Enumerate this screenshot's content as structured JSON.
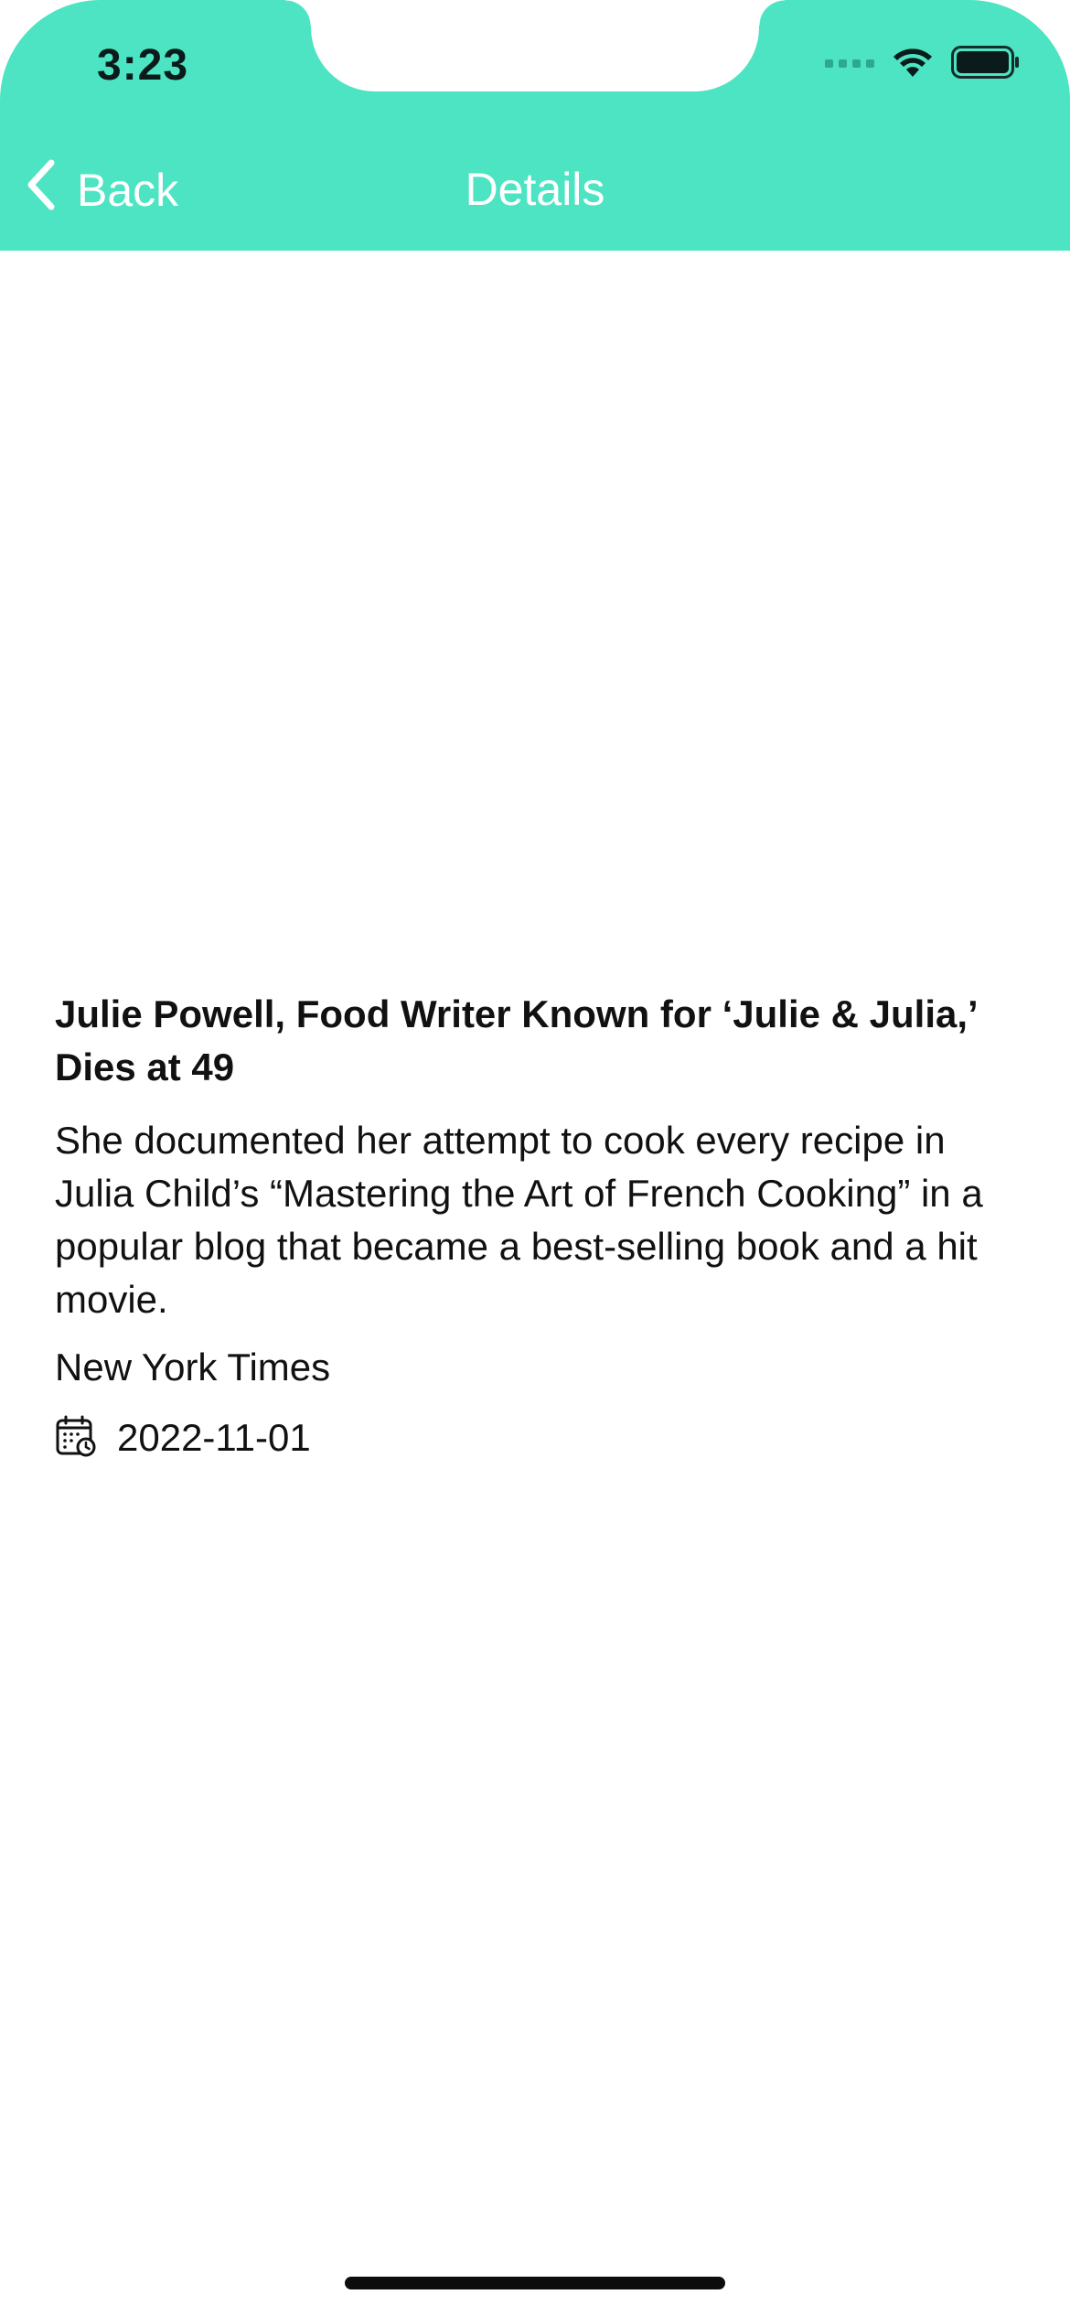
{
  "status_bar": {
    "time": "3:23",
    "icons": [
      "cellular-signal-icon",
      "wifi-icon",
      "battery-icon"
    ]
  },
  "nav": {
    "back_label": "Back",
    "title": "Details"
  },
  "article": {
    "headline": "Julie Powell, Food Writer Known for ‘Julie & Julia,’ Dies at 49",
    "summary": "She documented her attempt to cook every recipe in Julia Child’s “Mastering the Art of French Cooking” in a popular blog that became a best-selling book and a hit movie.",
    "source": "New York Times",
    "date": "2022-11-01",
    "date_icon": "calendar-clock-icon"
  },
  "colors": {
    "header_background": "#4ce4c2",
    "nav_text": "#ffffff",
    "body_text": "#111111"
  }
}
